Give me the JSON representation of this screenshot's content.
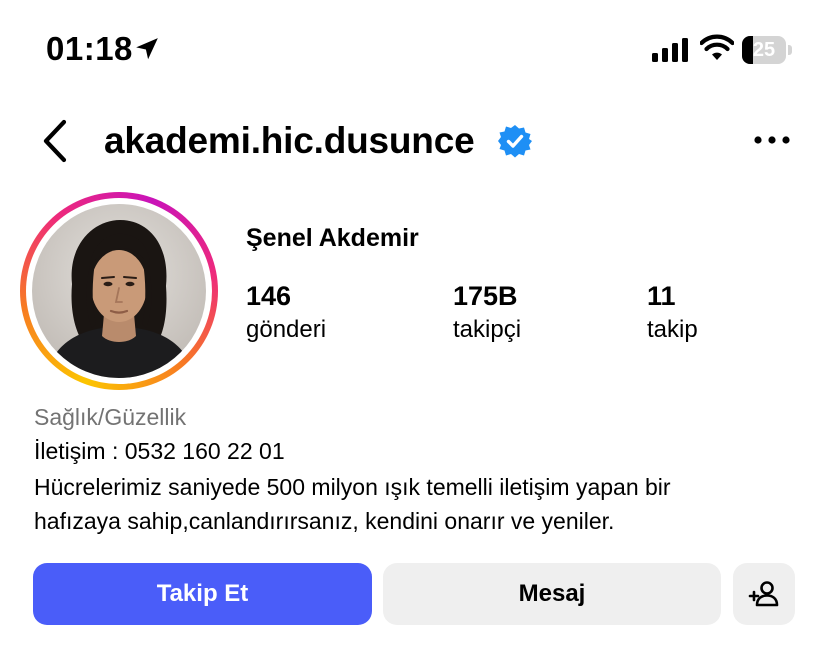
{
  "status_bar": {
    "time": "01:18",
    "battery_level": "25",
    "battery_fraction": 0.25,
    "icons": [
      "location-arrow-icon",
      "cellular-signal-icon",
      "wifi-icon",
      "battery-icon"
    ]
  },
  "header": {
    "username": "akademi.hic.dusunce",
    "verified": true,
    "icons": [
      "back-chevron-icon",
      "verified-badge-icon",
      "more-options-icon"
    ]
  },
  "profile": {
    "full_name": "Şenel Akdemir",
    "stats": [
      {
        "value": "146",
        "label": "gönderi"
      },
      {
        "value": "175B",
        "label": "takipçi"
      },
      {
        "value": "11",
        "label": "takip"
      }
    ],
    "category": "Sağlık/Güzellik",
    "bio_lines": [
      "İletişim : 0532 160 22 01",
      "Hücrelerimiz saniyede 500 milyon ışık temelli iletişim yapan bir",
      "hafızaya sahip,canlandırırsanız, kendini onarır ve yeniler."
    ]
  },
  "actions": {
    "follow_label": "Takip Et",
    "message_label": "Mesaj",
    "add_icon": "add-person-icon"
  },
  "colors": {
    "follow_button": "#4a5df9",
    "secondary_button": "#efefef",
    "verified_badge": "#1e8ff5",
    "category_text": "#737373"
  }
}
